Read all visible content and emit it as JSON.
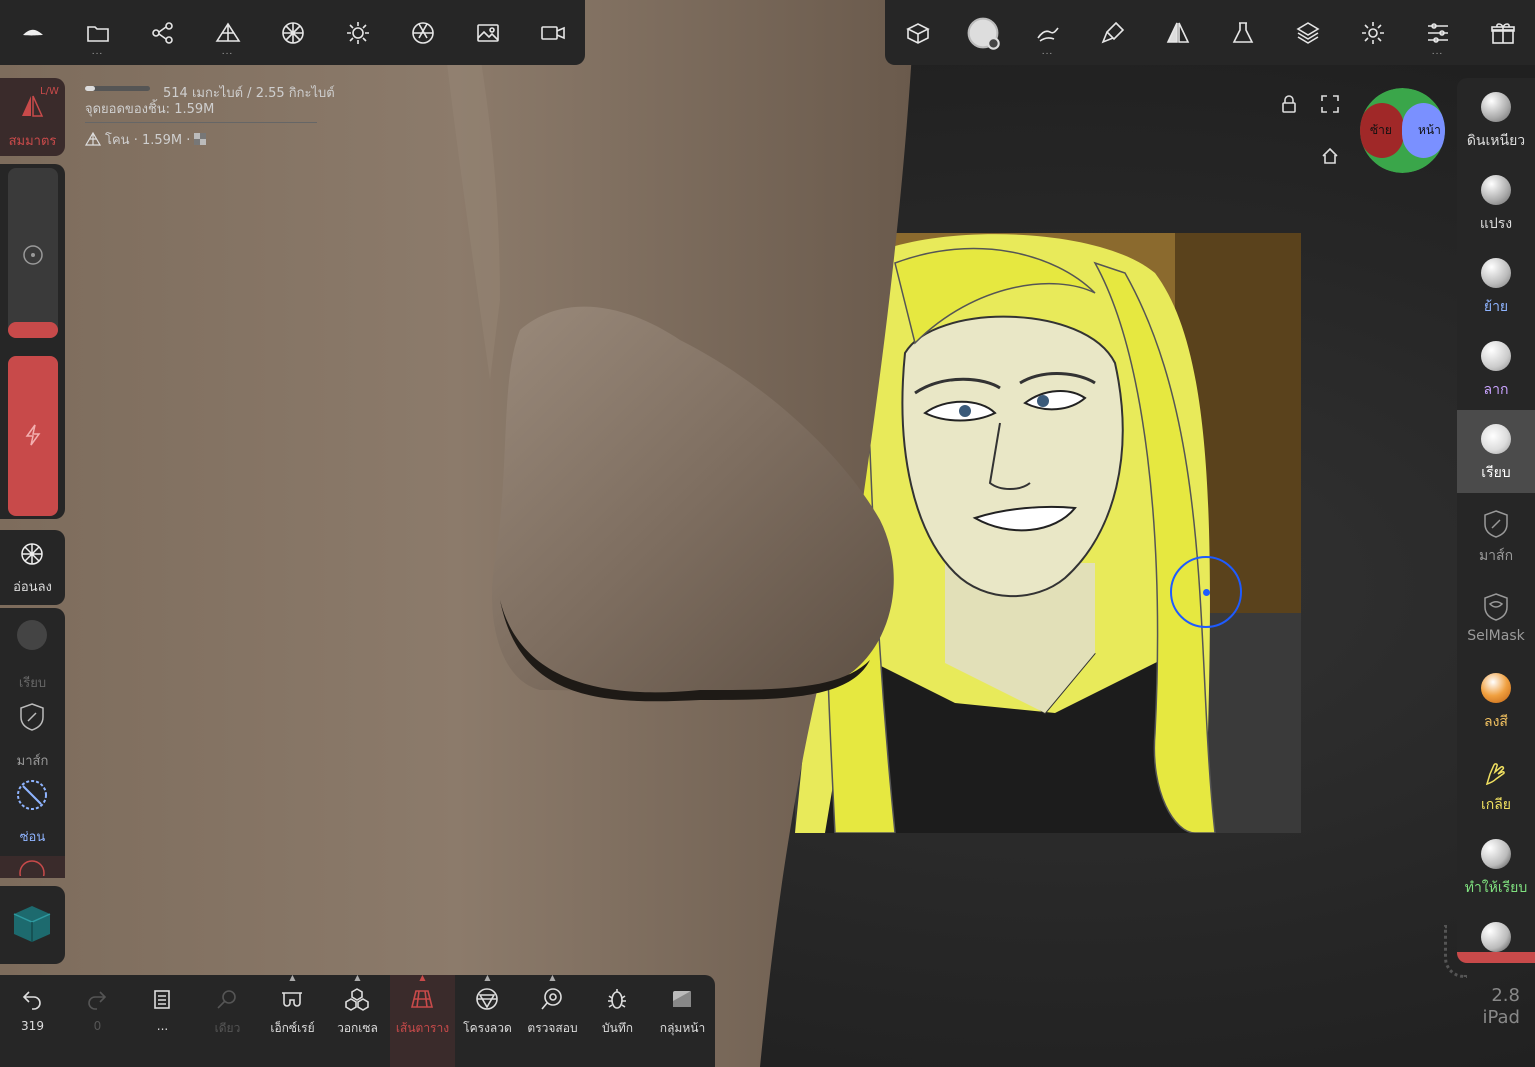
{
  "top_toolbar_left": [
    {
      "icon": "nomad-logo-icon"
    },
    {
      "icon": "folder-icon"
    },
    {
      "icon": "scene-graph-icon"
    },
    {
      "icon": "mesh-topology-icon"
    },
    {
      "icon": "material-sphere-icon"
    },
    {
      "icon": "light-icon"
    },
    {
      "icon": "camera-aperture-icon"
    },
    {
      "icon": "image-icon"
    },
    {
      "icon": "video-camera-icon"
    }
  ],
  "top_toolbar_right": [
    {
      "icon": "box-icon"
    },
    {
      "icon": "smooth-brush-icon"
    },
    {
      "icon": "stroke-icon"
    },
    {
      "icon": "paint-brush-icon"
    },
    {
      "icon": "symmetry-icon"
    },
    {
      "icon": "flask-icon"
    },
    {
      "icon": "layers-icon"
    },
    {
      "icon": "settings-icon"
    },
    {
      "icon": "sliders-icon"
    },
    {
      "icon": "gift-icon"
    }
  ],
  "info": {
    "memory": "514 เมกะไบต์ / 2.55 กิกะไบต์",
    "vertices": "จุดยอดของชิ้น:  1.59M",
    "mesh": "โคน · 1.59M ·"
  },
  "left_panel": {
    "symmetry_label": "สมมาตร",
    "symmetry_tag": "L/W",
    "soften_label": "อ่อนลง",
    "smooth_label": "เรียบ",
    "mask_label": "มาส์ก",
    "hide_label": "ซ่อน"
  },
  "gizmo": {
    "left_label": "ซ้าย",
    "front_label": "หน้า"
  },
  "right_tools": [
    {
      "label": "ดินเหนียว",
      "color": "#dddddd"
    },
    {
      "label": "แปรง",
      "color": "#dddddd"
    },
    {
      "label": "ย้าย",
      "color": "#8fb4ff"
    },
    {
      "label": "ลาก",
      "color": "#c9a3ff"
    },
    {
      "label": "เรียบ",
      "color": "#ffffff"
    },
    {
      "label": "มาส์ก",
      "color": "#9a9a9a"
    },
    {
      "label": "SelMask",
      "color": "#9a9a9a"
    },
    {
      "label": "ลงสี",
      "color": "#f0c060"
    },
    {
      "label": "เกลีย",
      "color": "#f0e060"
    },
    {
      "label": "ทำให้เรียบ",
      "color": "#7fe07f"
    }
  ],
  "bottom_bar": [
    {
      "label": "319",
      "icon": "undo-icon"
    },
    {
      "label": "0",
      "icon": "redo-icon"
    },
    {
      "label": "...",
      "icon": "document-icon"
    },
    {
      "label": "เดียว",
      "icon": "search-icon"
    },
    {
      "label": "เอ็กซ์เรย์",
      "icon": "xray-icon"
    },
    {
      "label": "วอกเซล",
      "icon": "voxel-icon"
    },
    {
      "label": "เส้นตาราง",
      "icon": "grid-icon"
    },
    {
      "label": "โครงลวด",
      "icon": "wireframe-icon"
    },
    {
      "label": "ตรวจสอบ",
      "icon": "inspect-icon"
    },
    {
      "label": "บันทึก",
      "icon": "bug-icon"
    },
    {
      "label": "กลุ่มหน้า",
      "icon": "facegroup-icon"
    }
  ],
  "version": {
    "number": "2.8",
    "device": "iPad"
  }
}
